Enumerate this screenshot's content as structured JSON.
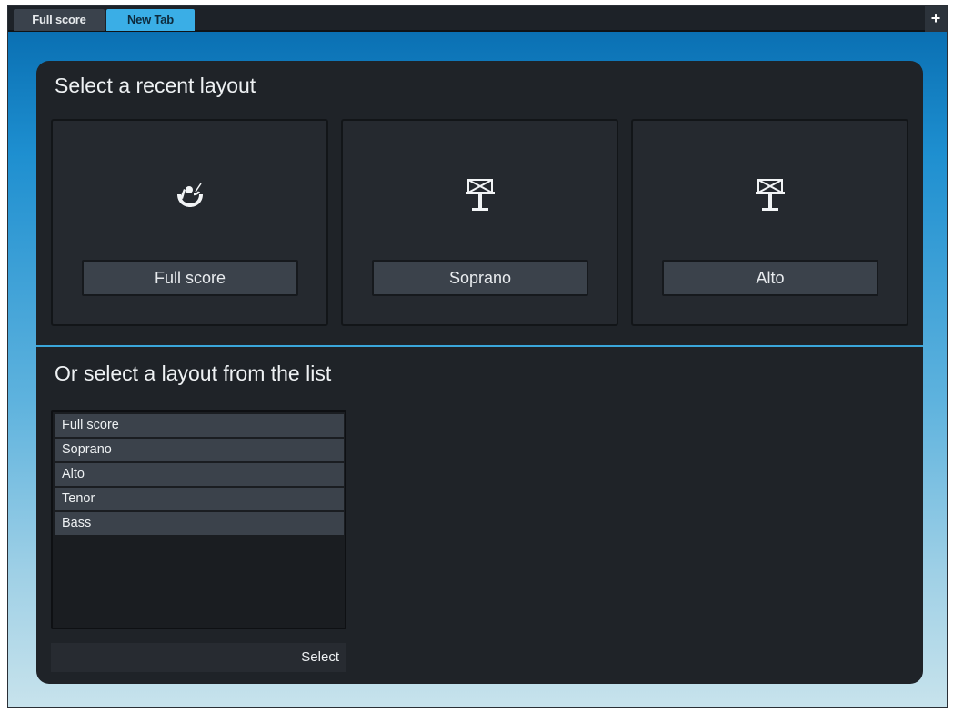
{
  "tabs": [
    {
      "label": "Full score",
      "active": false
    },
    {
      "label": "New Tab",
      "active": true
    }
  ],
  "add_tab_icon": "plus-icon",
  "recent": {
    "title": "Select a recent layout",
    "cards": [
      {
        "icon": "conductor-icon",
        "label": "Full score"
      },
      {
        "icon": "music-stand-icon",
        "label": "Soprano"
      },
      {
        "icon": "music-stand-icon",
        "label": "Alto"
      }
    ]
  },
  "list": {
    "title": "Or select a layout from the list",
    "items": [
      "Full score",
      "Soprano",
      "Alto",
      "Tenor",
      "Bass"
    ],
    "select_label": "Select"
  },
  "colors": {
    "active_tab": "#3aaee6",
    "panel": "#1f2328",
    "accent_divider": "#3aa6da"
  }
}
